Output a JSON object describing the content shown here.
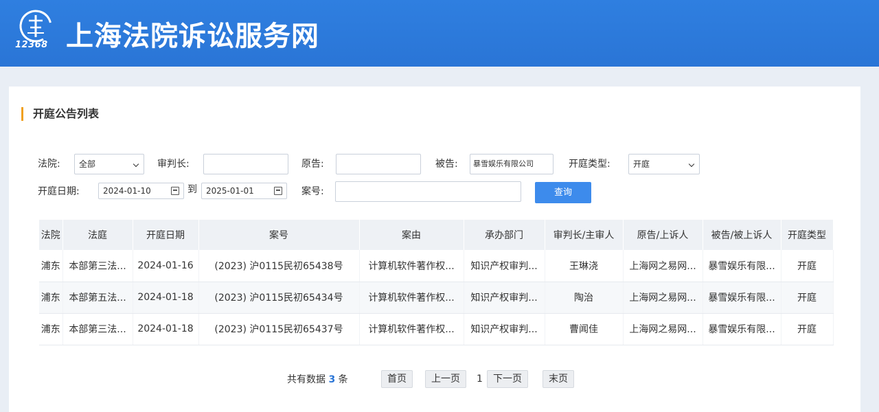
{
  "header": {
    "site_title": "上海法院诉讼服务网",
    "logo_number": "12368"
  },
  "section": {
    "title": "开庭公告列表"
  },
  "filters": {
    "court_label": "法院:",
    "court_value": "全部",
    "judge_label": "审判长:",
    "judge_value": "",
    "plaintiff_label": "原告:",
    "plaintiff_value": "",
    "defendant_label": "被告:",
    "defendant_value": "暴雪娱乐有限公司",
    "hearing_type_label": "开庭类型:",
    "hearing_type_value": "开庭",
    "date_label": "开庭日期:",
    "date_from": "2024-01-10",
    "date_to_label": "到",
    "date_to": "2025-01-01",
    "case_no_label": "案号:",
    "case_no_value": "",
    "query_label": "查询"
  },
  "table": {
    "headers": [
      "法院",
      "法庭",
      "开庭日期",
      "案号",
      "案由",
      "承办部门",
      "审判长/主审人",
      "原告/上诉人",
      "被告/被上诉人",
      "开庭类型"
    ],
    "rows": [
      [
        "浦东",
        "本部第三法...",
        "2024-01-16",
        "(2023) 沪0115民初65438号",
        "计算机软件著作权...",
        "知识产权审判...",
        "王琳浇",
        "上海网之易网...",
        "暴雪娱乐有限...",
        "开庭"
      ],
      [
        "浦东",
        "本部第五法...",
        "2024-01-18",
        "(2023) 沪0115民初65434号",
        "计算机软件著作权...",
        "知识产权审判...",
        "陶治",
        "上海网之易网...",
        "暴雪娱乐有限...",
        "开庭"
      ],
      [
        "浦东",
        "本部第三法...",
        "2024-01-18",
        "(2023) 沪0115民初65437号",
        "计算机软件著作权...",
        "知识产权审判...",
        "曹闻佳",
        "上海网之易网...",
        "暴雪娱乐有限...",
        "开庭"
      ]
    ]
  },
  "pagination": {
    "total_prefix": "共有数据",
    "total_count": "3",
    "total_suffix": "条",
    "first": "首页",
    "prev": "上一页",
    "current": "1",
    "next": "下一页",
    "last": "末页"
  },
  "colors": {
    "header_blue": "#2a75d6",
    "accent_orange": "#f0a020",
    "button_blue": "#3d8bec"
  }
}
